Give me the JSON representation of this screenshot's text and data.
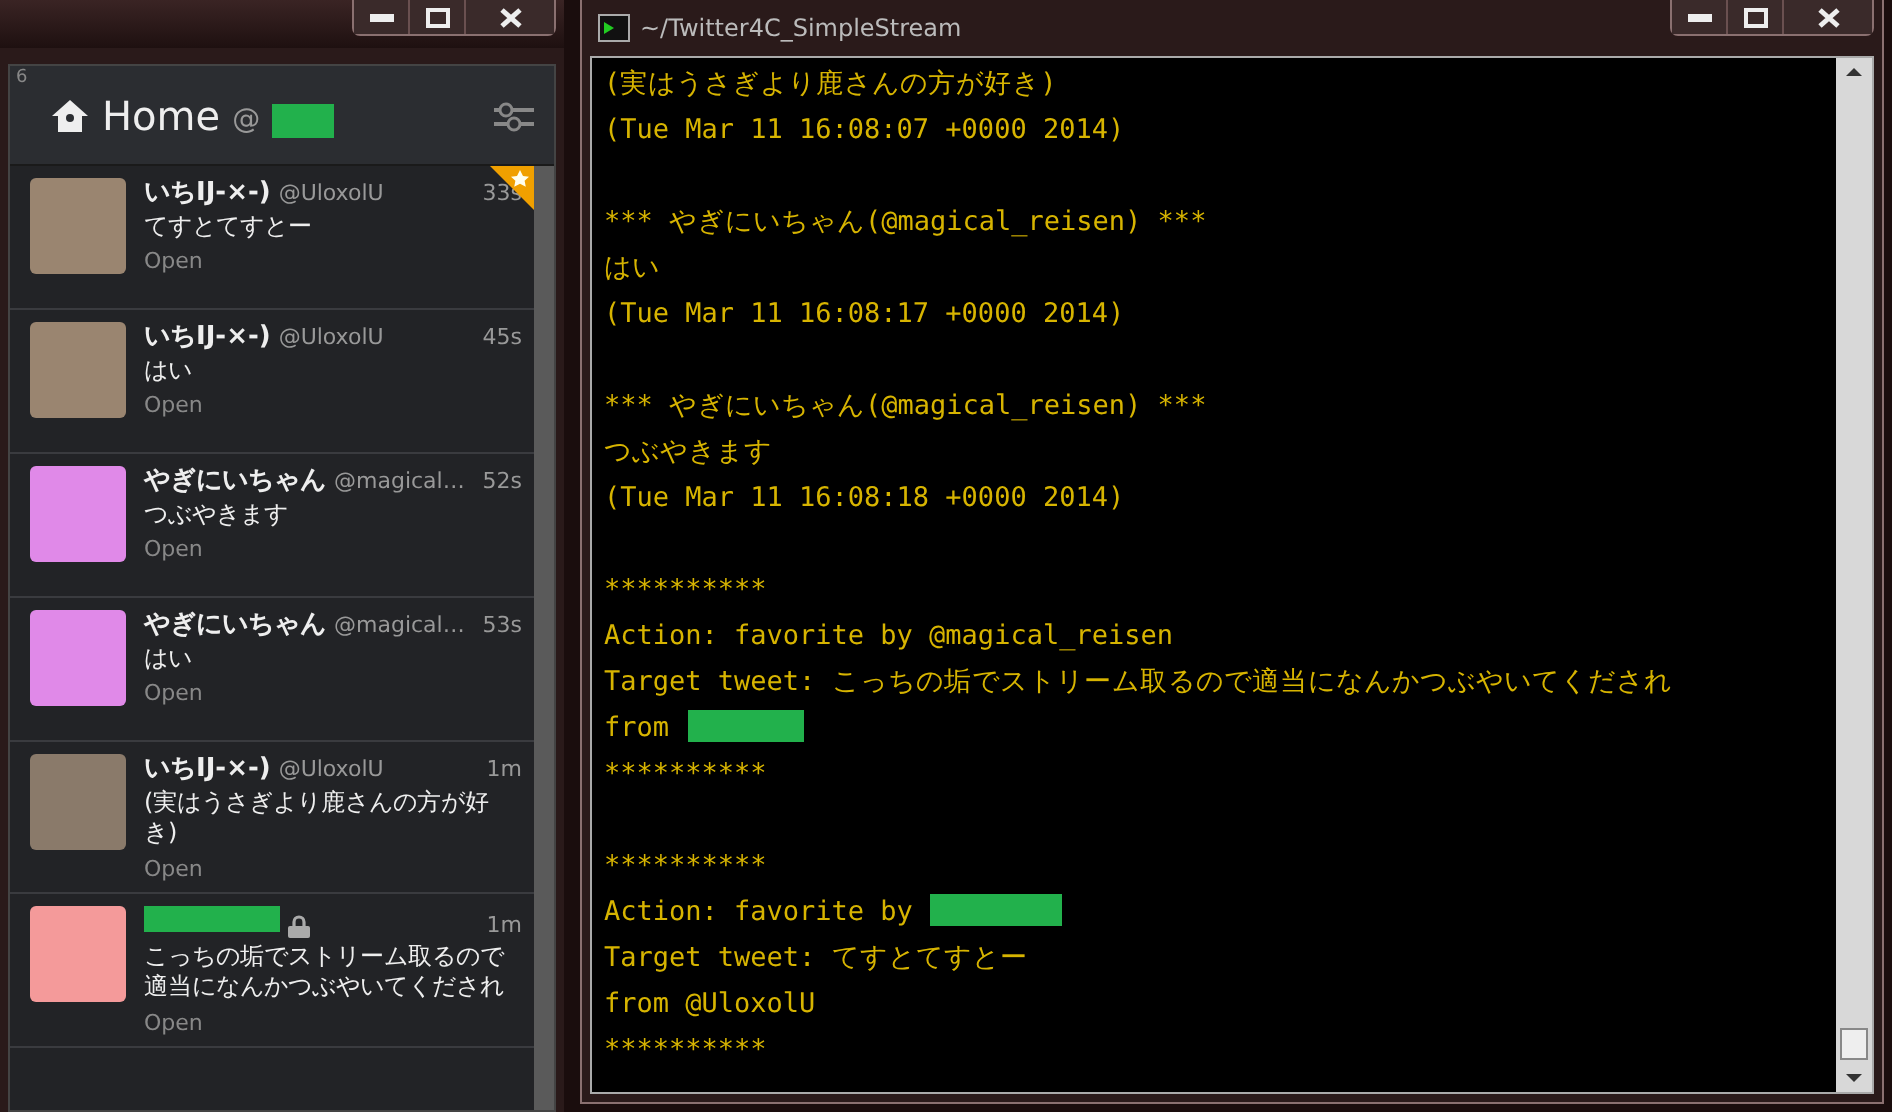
{
  "left_window": {
    "column": {
      "count": "6",
      "title": "Home",
      "at": "@",
      "account_redacted": true
    },
    "tweets": [
      {
        "name": "いちIJ-×-)",
        "name_redacted": false,
        "handle": "@UloxolU",
        "time": "33s",
        "text": "てすとてすとー",
        "action": "Open",
        "favorited": true,
        "locked": false,
        "color": "#9a8570"
      },
      {
        "name": "いちIJ-×-)",
        "name_redacted": false,
        "handle": "@UloxolU",
        "time": "45s",
        "text": "はい",
        "action": "Open",
        "favorited": false,
        "locked": false,
        "color": "#9a8570"
      },
      {
        "name": "やぎにいちゃん",
        "name_redacted": false,
        "handle": "@magical…",
        "time": "52s",
        "text": "つぶやきます",
        "action": "Open",
        "favorited": false,
        "locked": false,
        "color": "#e089e8"
      },
      {
        "name": "やぎにいちゃん",
        "name_redacted": false,
        "handle": "@magical…",
        "time": "53s",
        "text": "はい",
        "action": "Open",
        "favorited": false,
        "locked": false,
        "color": "#e089e8"
      },
      {
        "name": "いちIJ-×-)",
        "name_redacted": false,
        "handle": "@UloxolU",
        "time": "1m",
        "text": "(実はうさぎより鹿さんの方が好き)",
        "action": "Open",
        "favorited": false,
        "locked": false,
        "color": "#8a7a6a"
      },
      {
        "name_redacted": true,
        "time": "1m",
        "text": "こっちの垢でストリーム取るので適当になんかつぶやいてくだされ",
        "action": "Open",
        "favorited": false,
        "locked": true,
        "color": "#f49a9a"
      }
    ]
  },
  "terminal_window": {
    "title": "~/Twitter4C_SimpleStream",
    "lines": [
      {
        "kind": "text",
        "text": "(実はうさぎより鹿さんの方が好き)"
      },
      {
        "kind": "text",
        "text": "(Tue Mar 11 16:08:07 +0000 2014)"
      },
      {
        "kind": "blank"
      },
      {
        "kind": "text",
        "text": "*** やぎにいちゃん(@magical_reisen) ***"
      },
      {
        "kind": "text",
        "text": "はい"
      },
      {
        "kind": "text",
        "text": "(Tue Mar 11 16:08:17 +0000 2014)"
      },
      {
        "kind": "blank"
      },
      {
        "kind": "text",
        "text": "*** やぎにいちゃん(@magical_reisen) ***"
      },
      {
        "kind": "text",
        "text": "つぶやきます"
      },
      {
        "kind": "text",
        "text": "(Tue Mar 11 16:08:18 +0000 2014)"
      },
      {
        "kind": "blank"
      },
      {
        "kind": "text",
        "text": "**********"
      },
      {
        "kind": "text",
        "text": "Action: favorite by @magical_reisen"
      },
      {
        "kind": "text",
        "text": "Target tweet: こっちの垢でストリーム取るので適当になんかつぶやいてくだされ"
      },
      {
        "kind": "redacted",
        "text": "from"
      },
      {
        "kind": "text",
        "text": "**********"
      },
      {
        "kind": "blank"
      },
      {
        "kind": "text",
        "text": "**********"
      },
      {
        "kind": "redacted",
        "text": "Action: favorite by"
      },
      {
        "kind": "text",
        "text": "Target tweet: てすとてすとー"
      },
      {
        "kind": "text",
        "text": "from @UloxolU"
      },
      {
        "kind": "text",
        "text": "**********"
      }
    ]
  }
}
